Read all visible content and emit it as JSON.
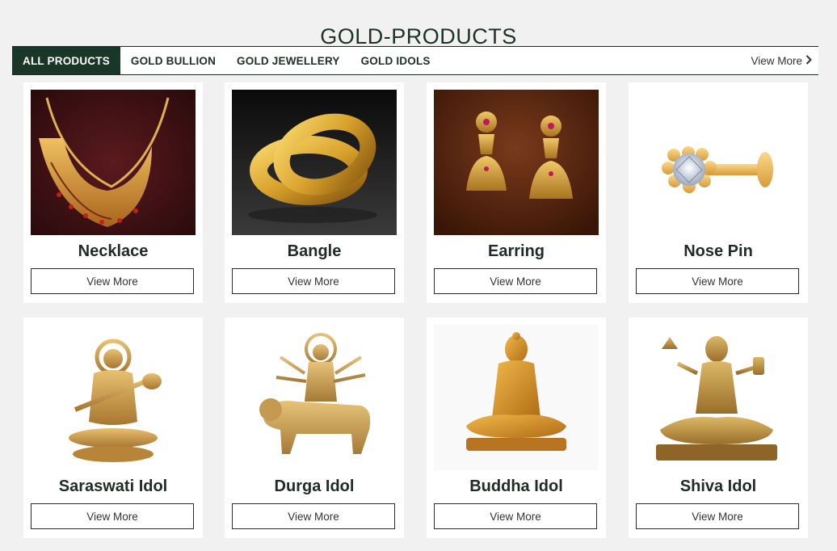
{
  "header": {
    "title": "GOLD-PRODUCTS"
  },
  "tabs": [
    {
      "label": "ALL PRODUCTS",
      "active": true
    },
    {
      "label": "GOLD BULLION",
      "active": false
    },
    {
      "label": "GOLD JEWELLERY",
      "active": false
    },
    {
      "label": "GOLD IDOLS",
      "active": false
    }
  ],
  "tabbar": {
    "view_more_label": "View More"
  },
  "products": [
    {
      "name": "Necklace",
      "button": "View More",
      "image": "necklace-image"
    },
    {
      "name": "Bangle",
      "button": "View More",
      "image": "bangle-image"
    },
    {
      "name": "Earring",
      "button": "View More",
      "image": "earring-image"
    },
    {
      "name": "Nose Pin",
      "button": "View More",
      "image": "nose-pin-image"
    },
    {
      "name": "Saraswati Idol",
      "button": "View More",
      "image": "saraswati-idol-image"
    },
    {
      "name": "Durga Idol",
      "button": "View More",
      "image": "durga-idol-image"
    },
    {
      "name": "Buddha Idol",
      "button": "View More",
      "image": "buddha-idol-image"
    },
    {
      "name": "Shiva Idol",
      "button": "View More",
      "image": "shiva-idol-image"
    }
  ],
  "colors": {
    "accent": "#1a3628",
    "background": "#f1f1f1",
    "gold": "#d4a63a"
  }
}
